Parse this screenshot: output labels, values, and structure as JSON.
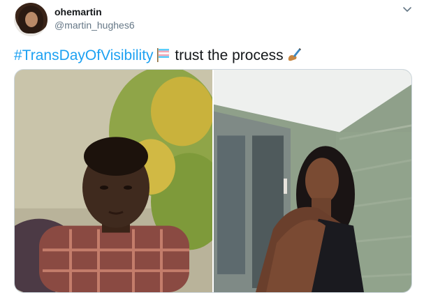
{
  "tweet": {
    "display_name": "ohemartin",
    "handle": "@martin_hughes6",
    "hashtag": "#TransDayOfVisibility",
    "text": " trust the process",
    "icons": {
      "avatar": "profile-photo",
      "menu": "chevron-down-icon",
      "flag": "transgender-flag-emoji-icon",
      "writing": "writing-hand-emoji-icon"
    },
    "colors": {
      "hashtag": "#1da1f2",
      "handle": "#657786",
      "media_border": "#ccd6dd"
    }
  },
  "media": {
    "photos": [
      "child-portrait-photo",
      "adult-portrait-photo"
    ]
  }
}
